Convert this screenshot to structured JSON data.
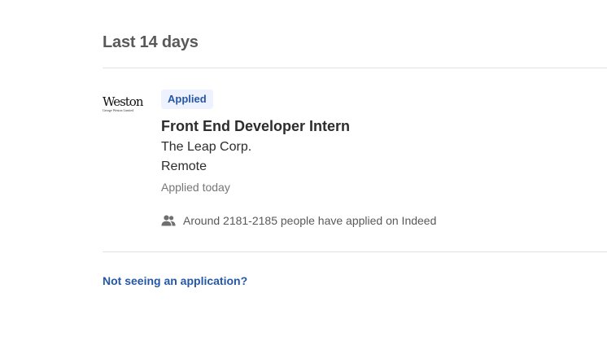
{
  "section": {
    "title": "Last 14 days"
  },
  "job": {
    "badge": "Applied",
    "title": "Front End Developer Intern",
    "company": "The Leap Corp.",
    "location": "Remote",
    "status": "Applied today",
    "applicants": "Around 2181-2185 people have applied on Indeed",
    "logo": {
      "main": "Weston",
      "sub": "George Weston Limited"
    },
    "icons": {
      "applicants": "people-icon"
    }
  },
  "footer": {
    "link": "Not seeing an application?"
  },
  "colors": {
    "accent": "#2557a7",
    "badge_bg": "#eef1fe",
    "divider": "#e4e2e0"
  }
}
